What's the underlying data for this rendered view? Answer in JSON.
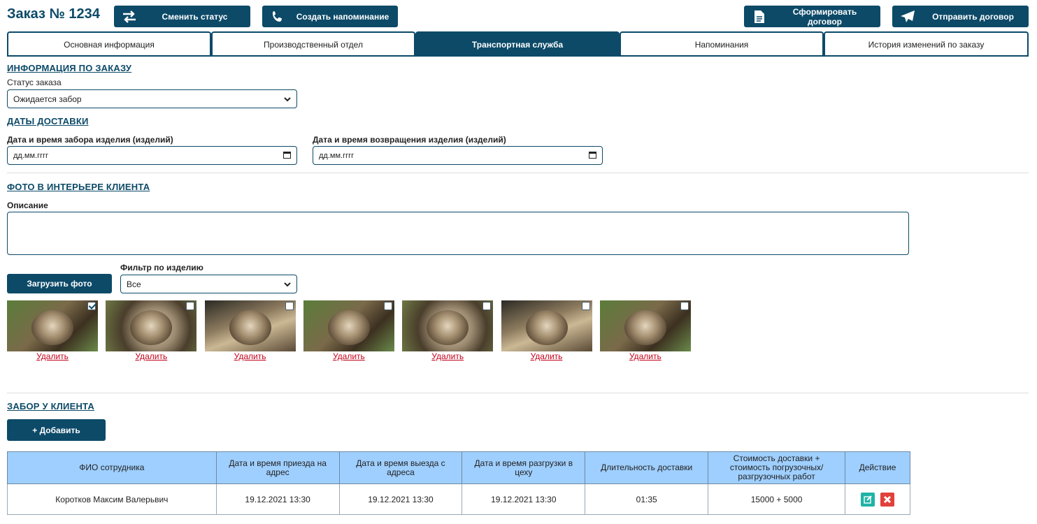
{
  "header": {
    "title": "Заказ № 1234",
    "change_status": "Сменить статус",
    "create_reminder": "Создать напоминание",
    "form_contract": "Сформировать договор",
    "send_contract": "Отправить договор"
  },
  "tabs": [
    {
      "label": "Основная информация",
      "active": false
    },
    {
      "label": "Производственный отдел",
      "active": false
    },
    {
      "label": "Транспортная служба",
      "active": true
    },
    {
      "label": "Напоминания",
      "active": false
    },
    {
      "label": "История изменений по заказу",
      "active": false
    }
  ],
  "order_info": {
    "title": "ИНФОРМАЦИЯ ПО ЗАКАЗУ",
    "status_label": "Статус заказа",
    "status_value": "Ожидается забор"
  },
  "delivery_dates": {
    "title": "ДАТЫ ДОСТАВКИ",
    "pickup_label": "Дата и время забора изделия (изделий)",
    "pickup_placeholder": "дд.мм.гггг",
    "return_label": "Дата и время возвращения изделия (изделий)",
    "return_placeholder": "дд.мм.гггг"
  },
  "photos": {
    "title": "ФОТО В ИНТЕРЬЕРЕ КЛИЕНТА",
    "description_label": "Описание",
    "upload_button": "Загрузить фото",
    "filter_label": "Фильтр по изделию",
    "filter_value": "Все",
    "delete_label": "Удалить",
    "items": [
      {
        "checked": true
      },
      {
        "checked": false
      },
      {
        "checked": false
      },
      {
        "checked": false
      },
      {
        "checked": false
      },
      {
        "checked": false
      },
      {
        "checked": false
      }
    ]
  },
  "pickup": {
    "title": "ЗАБОР У КЛИЕНТА",
    "add_button": "+ Добавить",
    "columns": [
      "ФИО сотрудника",
      "Дата и время приезда на адрес",
      "Дата и время выезда с адреса",
      "Дата и время разгрузки в цеху",
      "Длительность доставки",
      "Стоимость доставки + стоимость погрузочных/ разгрузочных работ",
      "Действие"
    ],
    "rows": [
      [
        "Коротков Максим Валерьвич",
        "19.12.2021 13:30",
        "19.12.2021 13:30",
        "19.12.2021 13:30",
        "01:35",
        "15000 + 5000"
      ]
    ]
  },
  "colors": {
    "primary": "#0c4a68",
    "table_header": "#9fcfff",
    "delete_link": "#c4001a",
    "edit_action": "#1fb3a6",
    "remove_action": "#e2403b"
  }
}
